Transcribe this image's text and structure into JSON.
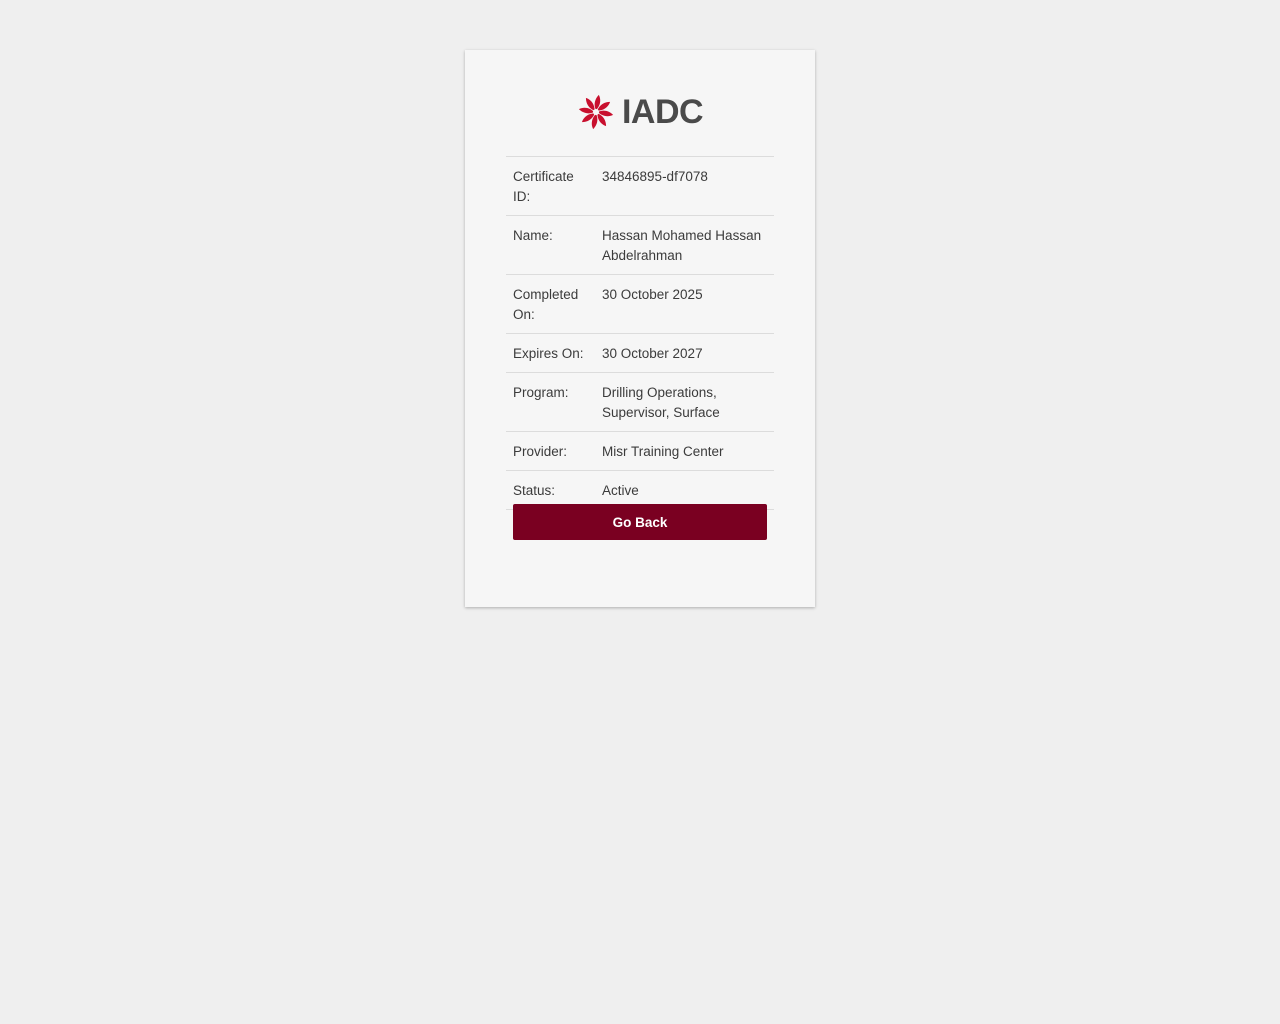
{
  "brand": {
    "name": "IADC",
    "logo_icon": "iadc-pinwheel-icon",
    "accent": "#c8102e",
    "text_color": "#4a4a4a"
  },
  "certificate": {
    "rows": [
      {
        "label": "Certificate ID:",
        "value": "34846895-df7078"
      },
      {
        "label": "Name:",
        "value": "Hassan Mohamed Hassan Abdelrahman"
      },
      {
        "label": "Completed On:",
        "value": "30 October 2025"
      },
      {
        "label": "Expires On:",
        "value": "30 October 2027"
      },
      {
        "label": "Program:",
        "value": "Drilling Operations, Supervisor, Surface"
      },
      {
        "label": "Provider:",
        "value": "Misr Training Center"
      },
      {
        "label": "Status:",
        "value": "Active"
      }
    ]
  },
  "actions": {
    "go_back_label": "Go Back",
    "button_color": "#7a0021"
  }
}
